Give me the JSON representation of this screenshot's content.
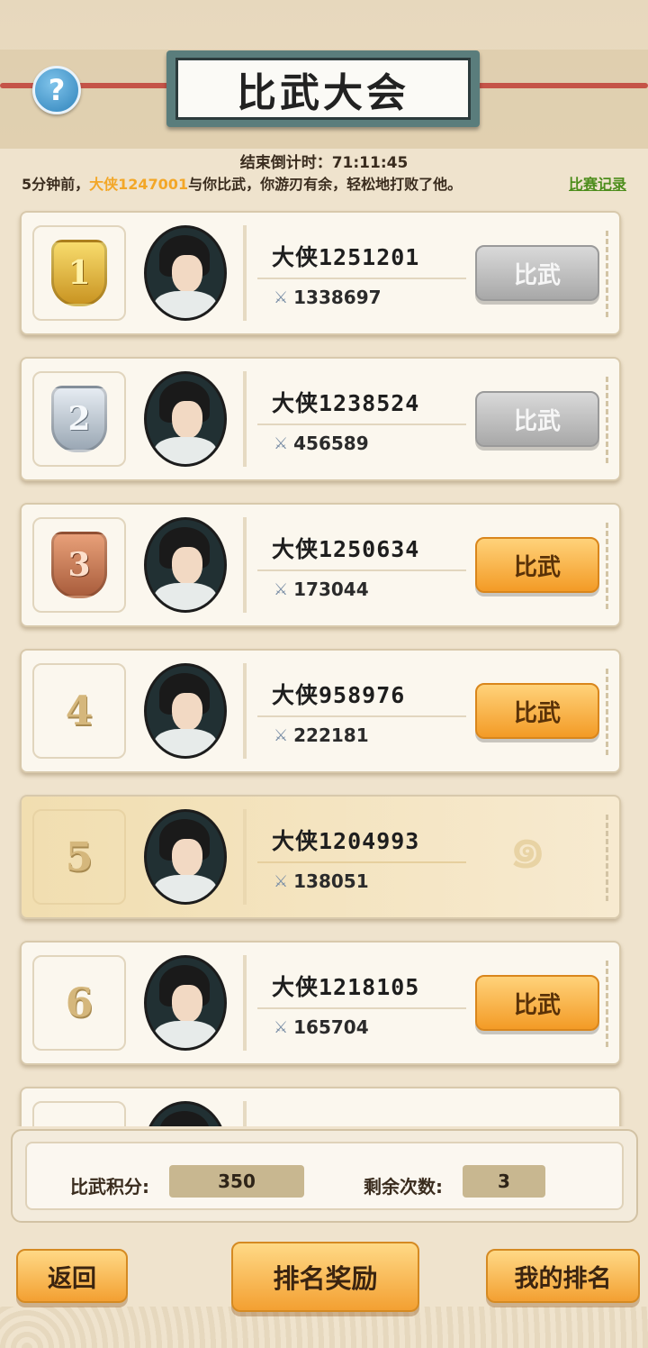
{
  "title": "比武大会",
  "countdown": {
    "label": "结束倒计时：",
    "value": "71:11:45"
  },
  "news": {
    "prefix": "5分钟前，",
    "player": "大侠1247001",
    "suffix": "与你比武，你游刃有余，轻松地打败了他。",
    "record_link": "比赛记录"
  },
  "players": [
    {
      "rank": "1",
      "medal": "gold",
      "name": "大侠1251201",
      "power": "1338697",
      "button": "比武",
      "button_enabled": false
    },
    {
      "rank": "2",
      "medal": "silver",
      "name": "大侠1238524",
      "power": "456589",
      "button": "比武",
      "button_enabled": false
    },
    {
      "rank": "3",
      "medal": "bronze",
      "name": "大侠1250634",
      "power": "173044",
      "button": "比武",
      "button_enabled": true
    },
    {
      "rank": "4",
      "medal": "",
      "name": "大侠958976",
      "power": "222181",
      "button": "比武",
      "button_enabled": true
    },
    {
      "rank": "5",
      "medal": "",
      "name": "大侠1204993",
      "power": "138051",
      "button": "",
      "button_enabled": false,
      "is_self": true
    },
    {
      "rank": "6",
      "medal": "",
      "name": "大侠1218105",
      "power": "165704",
      "button": "比武",
      "button_enabled": true
    }
  ],
  "score": {
    "points_label": "比武积分:",
    "points_value": "350",
    "remaining_label": "剩余次数:",
    "remaining_value": "3"
  },
  "buttons": {
    "back": "返回",
    "rank_reward": "排名奖励",
    "my_rank": "我的排名"
  },
  "colors": {
    "accent_orange": "#f39b26",
    "highlight_name": "#f3a727",
    "link_green": "#4d8d1c"
  }
}
